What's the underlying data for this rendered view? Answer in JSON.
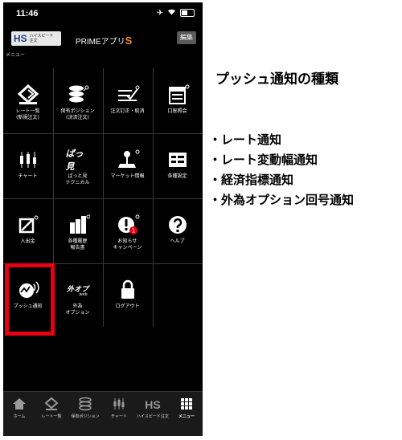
{
  "status_bar": {
    "time": "11:46"
  },
  "header": {
    "hs_mark": "HS",
    "hs_sub_line1": "ハイスピード",
    "hs_sub_line2": "注文",
    "title_main": "PRIMEアプリ",
    "title_s": "S",
    "edit_label": "編集"
  },
  "menu_label": "メニュー",
  "grid": {
    "items": [
      {
        "l1": "レート一覧",
        "l2": "(新規注文)"
      },
      {
        "l1": "保有ポジション",
        "l2": "(決済注文)"
      },
      {
        "l1": "注文訂正・取消",
        "l2": ""
      },
      {
        "l1": "口座照会",
        "l2": ""
      },
      {
        "l1": "チャート",
        "l2": ""
      },
      {
        "l1": "ぱっと見",
        "l2": "テクニカル"
      },
      {
        "l1": "マーケット情報",
        "l2": ""
      },
      {
        "l1": "各種設定",
        "l2": ""
      },
      {
        "l1": "入出金",
        "l2": ""
      },
      {
        "l1": "各種履歴",
        "l2": "報告書"
      },
      {
        "l1": "お知らせ",
        "l2": "キャンペーン"
      },
      {
        "l1": "ヘルプ",
        "l2": ""
      },
      {
        "l1": "プッシュ通知",
        "l2": ""
      },
      {
        "l1": "外為",
        "l2": "オプション"
      },
      {
        "l1": "ログアウト",
        "l2": ""
      }
    ],
    "badge_count": "1",
    "patto_icon_text": "ぱっ見",
    "gaitame_icon_text": "外オプ",
    "gaitame_icon_sub": "web"
  },
  "tabbar": {
    "items": [
      {
        "label": "ホーム"
      },
      {
        "label": "レート一覧"
      },
      {
        "label": "保有ポジション"
      },
      {
        "label": "チャート"
      },
      {
        "label": "ハイスピード注文"
      },
      {
        "label": "メニュー"
      }
    ],
    "hs_icon_text": "HS"
  },
  "info": {
    "title": "プッシュ通知の種類",
    "items": [
      "・レート通知",
      "・レート変動幅通知",
      "・経済指標通知",
      "・外為オプション回号通知"
    ]
  },
  "colors": {
    "highlight": "#e60012",
    "accent_orange": "#f08c28",
    "badge_red": "#e60012"
  }
}
